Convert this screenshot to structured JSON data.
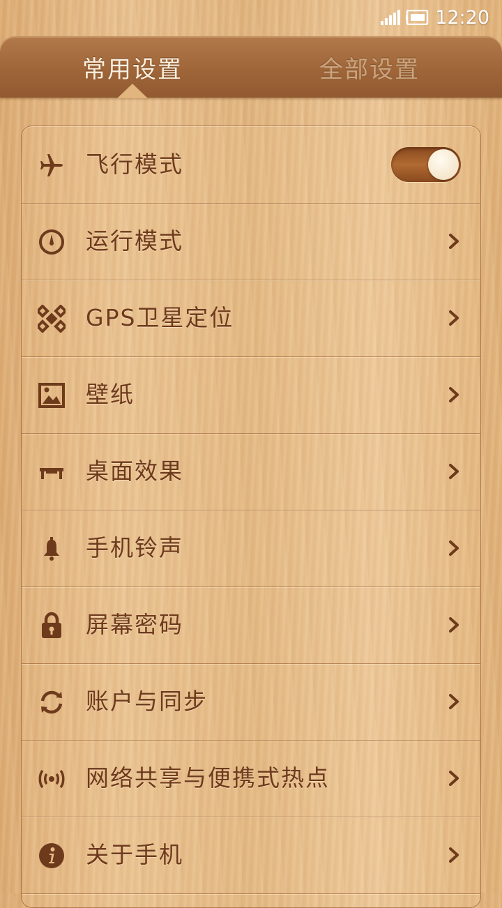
{
  "status_bar": {
    "time": "12:20",
    "signal_icon": "signal-bars-icon",
    "battery_icon": "battery-icon"
  },
  "tabs": [
    {
      "label": "常用设置",
      "selected": true
    },
    {
      "label": "全部设置",
      "selected": false
    }
  ],
  "settings": [
    {
      "label": "飞行模式",
      "icon": "airplane-icon",
      "control": "toggle",
      "toggle_on": true
    },
    {
      "label": "运行模式",
      "icon": "gauge-icon",
      "control": "chevron"
    },
    {
      "label": "GPS卫星定位",
      "icon": "satellite-icon",
      "control": "chevron"
    },
    {
      "label": "壁纸",
      "icon": "picture-icon",
      "control": "chevron"
    },
    {
      "label": "桌面效果",
      "icon": "desk-icon",
      "control": "chevron"
    },
    {
      "label": "手机铃声",
      "icon": "bell-icon",
      "control": "chevron"
    },
    {
      "label": "屏幕密码",
      "icon": "lock-icon",
      "control": "chevron"
    },
    {
      "label": "账户与同步",
      "icon": "sync-icon",
      "control": "chevron"
    },
    {
      "label": "网络共享与便携式热点",
      "icon": "hotspot-icon",
      "control": "chevron"
    },
    {
      "label": "关于手机",
      "icon": "info-icon",
      "control": "chevron"
    }
  ],
  "colors": {
    "label_text": "#6e3a1c",
    "icon": "#6e3a1c",
    "tab_active": "#fbf0df",
    "tab_inactive": "#c9a580"
  }
}
